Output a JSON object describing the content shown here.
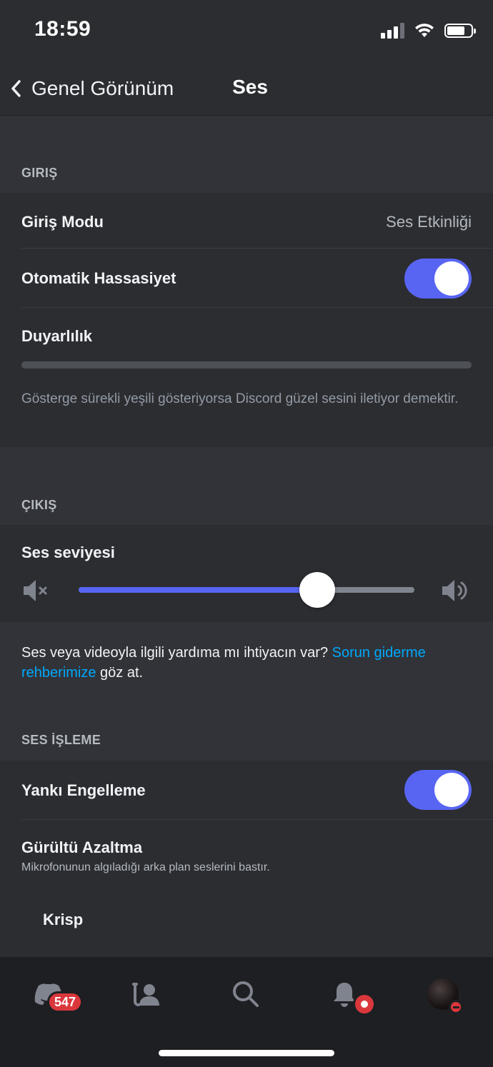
{
  "status_bar": {
    "time": "18:59"
  },
  "header": {
    "back_label": "Genel Görünüm",
    "title": "Ses"
  },
  "input_section": {
    "label": "GIRIŞ",
    "mode": {
      "title": "Giriş Modu",
      "value": "Ses Etkinliği"
    },
    "auto_sensitivity": {
      "title": "Otomatik Hassasiyet",
      "enabled": true
    },
    "sensitivity": {
      "title": "Duyarlılık"
    },
    "hint": "Gösterge sürekli yeşili gösteriyorsa Discord güzel sesini iletiyor demektir."
  },
  "output_section": {
    "label": "ÇIKIŞ",
    "volume": {
      "title": "Ses seviyesi",
      "level_percent": 71
    }
  },
  "help": {
    "text_before": "Ses veya videoyla ilgili yardıma mı ihtiyacın var? ",
    "link_text": "Sorun giderme rehberimize",
    "text_after": " göz at."
  },
  "processing_section": {
    "label": "SES İŞLEME",
    "echo_cancellation": {
      "title": "Yankı Engelleme",
      "enabled": true
    },
    "noise_reduction": {
      "title": "Gürültü Azaltma",
      "subtitle": "Mikrofonunun algıladığı arka plan seslerini bastır."
    },
    "option": "Krisp"
  },
  "tabbar": {
    "servers_badge": "547"
  },
  "colors": {
    "accent": "#5865f2",
    "link": "#00a8fc",
    "badge": "#da373c",
    "background": "#313338",
    "card": "#2b2d31"
  },
  "icons": [
    "back-chevron-icon",
    "mute-speaker-icon",
    "loud-speaker-icon",
    "discord-home-icon",
    "friends-icon",
    "search-icon",
    "bell-icon"
  ]
}
